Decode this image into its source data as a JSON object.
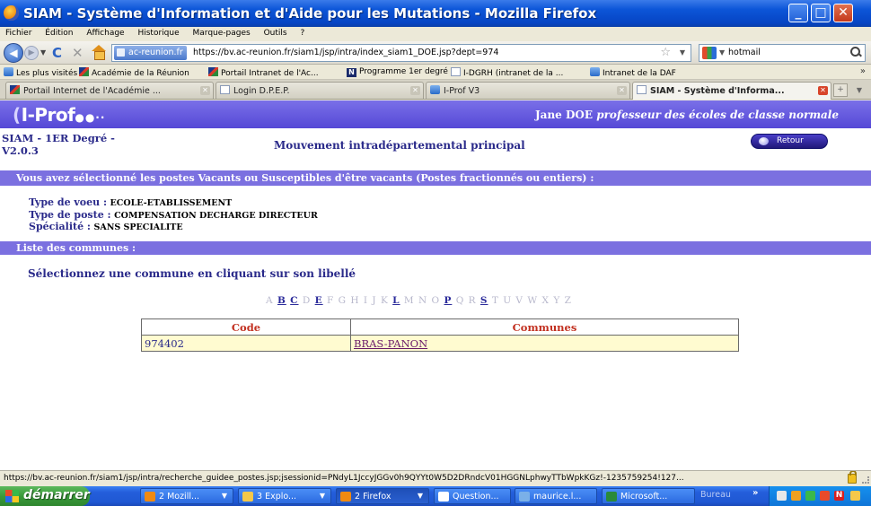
{
  "window": {
    "title": "SIAM - Système d'Information et d'Aide pour les Mutations - Mozilla Firefox"
  },
  "menu": [
    "Fichier",
    "Édition",
    "Affichage",
    "Historique",
    "Marque-pages",
    "Outils",
    "?"
  ],
  "nav": {
    "site_identity": "ac-reunion.fr",
    "url": "https://bv.ac-reunion.fr/siam1/jsp/intra/index_siam1_DOE.jsp?dept=974",
    "search_value": "hotmail"
  },
  "bookmarks": [
    {
      "label": "Les plus visités",
      "icon": "blue"
    },
    {
      "label": "Académie de la Réunion",
      "icon": "acad"
    },
    {
      "label": "Portail Intranet de l'Ac...",
      "icon": "acad"
    },
    {
      "label": "Programme 1er degré",
      "icon": "n"
    },
    {
      "label": "I-DGRH (intranet de la ...",
      "icon": "page"
    },
    {
      "label": "Intranet de la DAF",
      "icon": "blue"
    }
  ],
  "tabs": [
    {
      "label": "Portail Internet de l'Académie ...",
      "active": false
    },
    {
      "label": "Login D.P.E.P.",
      "active": false
    },
    {
      "label": "I-Prof V3",
      "active": false
    },
    {
      "label": "SIAM - Système d'Informa...",
      "active": true
    }
  ],
  "header": {
    "logo": "I-Prof",
    "logo_dots": "●●··",
    "user_name": "Jane DOE",
    "user_role": "professeur des écoles de classe normale"
  },
  "subheader": {
    "app_name": "SIAM - 1ER Degré - V2.0.3",
    "page_title": "Mouvement intradépartemental principal",
    "back_button": "Retour"
  },
  "selection": {
    "banner": "Vous avez sélectionné les postes Vacants ou Susceptibles d'être vacants (Postes fractionnés ou entiers) :",
    "voeu_label": "Type de voeu :",
    "voeu_value": "ECOLE-ETABLISSEMENT",
    "poste_label": "Type de poste :",
    "poste_value": "COMPENSATION DECHARGE DIRECTEUR",
    "specialite_label": "Spécialité :",
    "specialite_value": "SANS SPECIALITE"
  },
  "communes": {
    "banner": "Liste des communes :",
    "instruction": "Sélectionnez une commune en cliquant sur son libellé",
    "alphabet": [
      {
        "letter": "A",
        "link": false
      },
      {
        "letter": "B",
        "link": true
      },
      {
        "letter": "C",
        "link": true
      },
      {
        "letter": "D",
        "link": false
      },
      {
        "letter": "E",
        "link": true
      },
      {
        "letter": "F",
        "link": false
      },
      {
        "letter": "G",
        "link": false
      },
      {
        "letter": "H",
        "link": false
      },
      {
        "letter": "I",
        "link": false
      },
      {
        "letter": "J",
        "link": false
      },
      {
        "letter": "K",
        "link": false
      },
      {
        "letter": "L",
        "link": true
      },
      {
        "letter": "M",
        "link": false
      },
      {
        "letter": "N",
        "link": false
      },
      {
        "letter": "O",
        "link": false
      },
      {
        "letter": "P",
        "link": true
      },
      {
        "letter": "Q",
        "link": false
      },
      {
        "letter": "R",
        "link": false
      },
      {
        "letter": "S",
        "link": true
      },
      {
        "letter": "T",
        "link": false
      },
      {
        "letter": "U",
        "link": false
      },
      {
        "letter": "V",
        "link": false
      },
      {
        "letter": "W",
        "link": false
      },
      {
        "letter": "X",
        "link": false
      },
      {
        "letter": "Y",
        "link": false
      },
      {
        "letter": "Z",
        "link": false
      }
    ],
    "columns": [
      "Code",
      "Communes"
    ],
    "rows": [
      {
        "code": "974402",
        "commune": "BRAS-PANON"
      }
    ]
  },
  "status": {
    "text": "https://bv.ac-reunion.fr/siam1/jsp/intra/recherche_guidee_postes.jsp;jsessionid=PNdyL1JccyJGGv0h9QYYt0W5D2DRndcV01HGGNLphwyTTbWpkKGz!-1235759254!127..."
  },
  "taskbar": {
    "start_label": "démarrer",
    "items": [
      {
        "label": "2 Mozill...",
        "icon_color": "#f08a12",
        "pressed": false
      },
      {
        "label": "3 Explo...",
        "icon_color": "#f5c84a",
        "pressed": false
      },
      {
        "label": "2 Firefox",
        "icon_color": "#f08a12",
        "pressed": true
      },
      {
        "label": "Question...",
        "icon_color": "#ffffff",
        "pressed": false
      },
      {
        "label": "maurice.l...",
        "icon_color": "#7ab0e8",
        "pressed": false
      },
      {
        "label": "Microsoft...",
        "icon_color": "#2a8a3a",
        "pressed": false
      }
    ],
    "tray_label": "Bureau"
  }
}
